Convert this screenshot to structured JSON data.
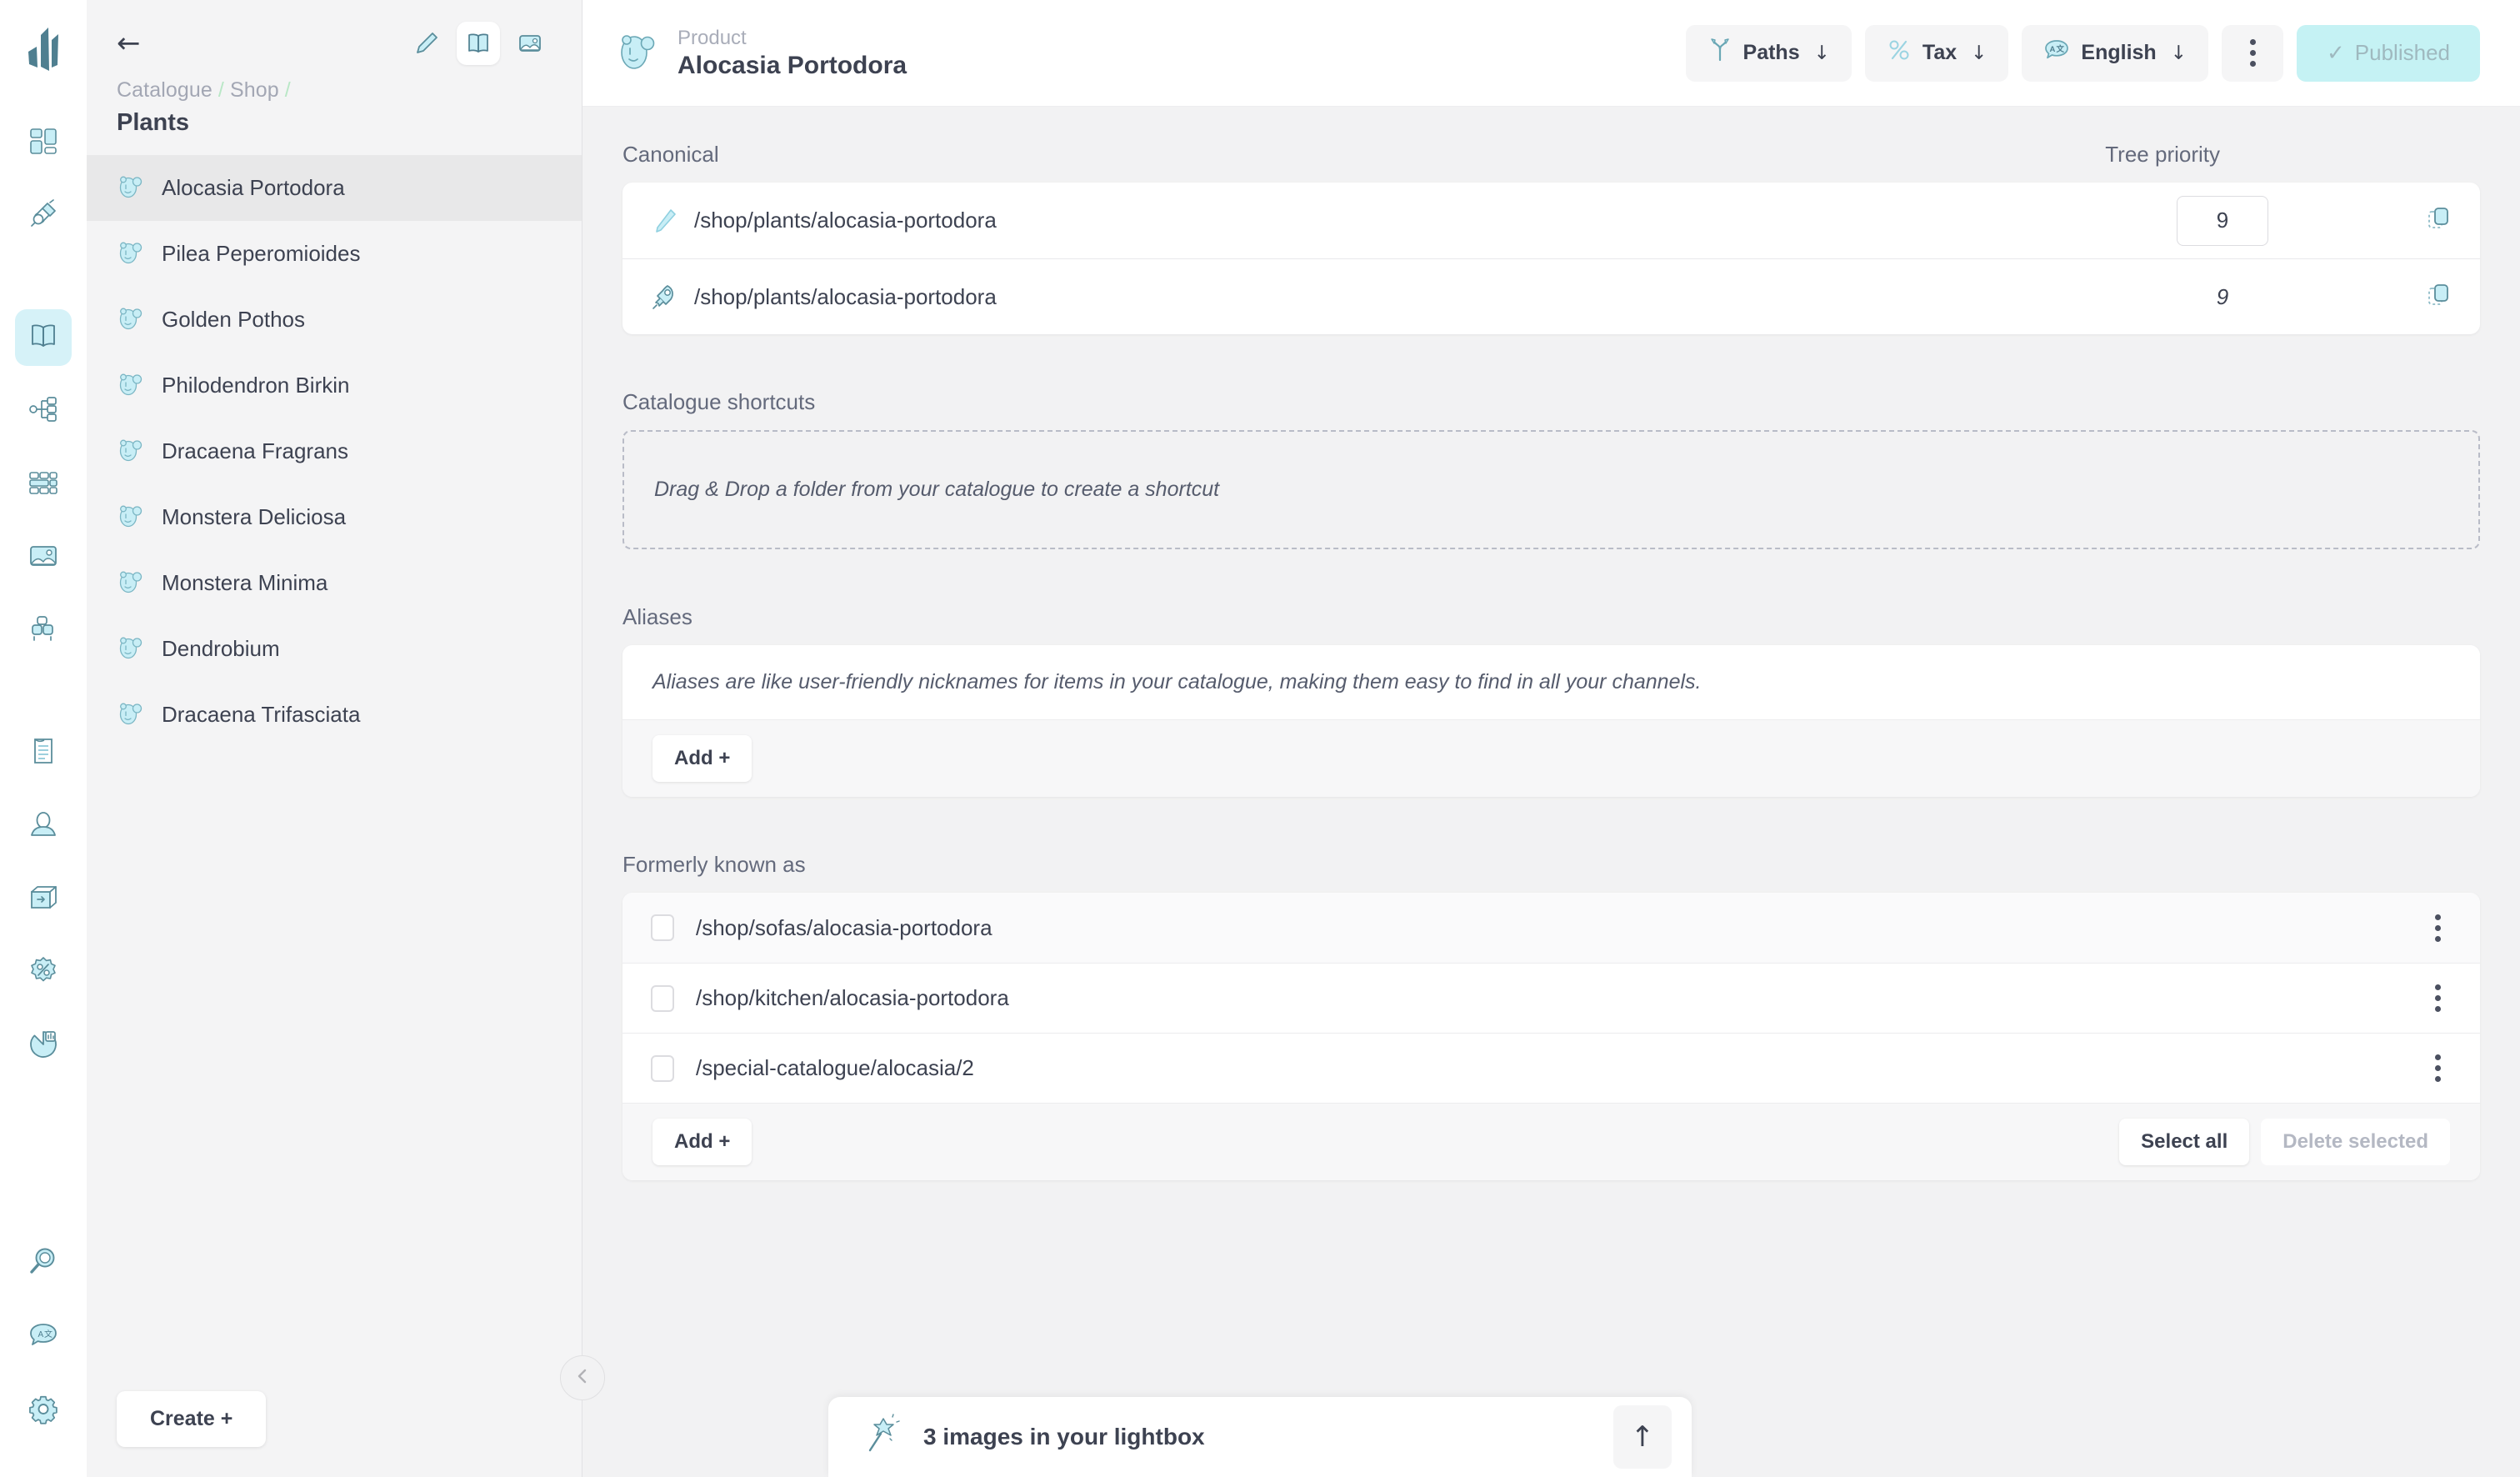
{
  "rail": {
    "logo_name": "crystallize-logo",
    "top_items": [
      {
        "name": "dashboard-icon",
        "label": "Dashboard",
        "active": false
      },
      {
        "name": "plug-icon",
        "label": "Integrations",
        "active": false
      }
    ],
    "main_items": [
      {
        "name": "catalogue-book-icon",
        "label": "Catalogue",
        "active": true
      },
      {
        "name": "topic-tree-icon",
        "label": "Topics",
        "active": false
      },
      {
        "name": "grid-layout-icon",
        "label": "Layouts",
        "active": false
      },
      {
        "name": "image-icon",
        "label": "Media",
        "active": false
      },
      {
        "name": "shapes-icon",
        "label": "Shapes",
        "active": false
      }
    ],
    "lower_items": [
      {
        "name": "document-icon",
        "label": "Documents",
        "active": false
      },
      {
        "name": "customer-icon",
        "label": "Customers",
        "active": false
      },
      {
        "name": "orders-box-icon",
        "label": "Orders",
        "active": false
      },
      {
        "name": "discount-icon",
        "label": "Discounts",
        "active": false
      },
      {
        "name": "analytics-pie-icon",
        "label": "Analytics",
        "active": false
      }
    ],
    "bottom_items": [
      {
        "name": "search-icon",
        "label": "Search",
        "active": false
      },
      {
        "name": "translate-icon",
        "label": "Translate",
        "active": false
      },
      {
        "name": "gear-icon",
        "label": "Settings",
        "active": false
      }
    ]
  },
  "panel": {
    "back_icon": "back-arrow-icon",
    "tools": [
      {
        "name": "pencil-icon",
        "label": "Edit",
        "active": false
      },
      {
        "name": "book-icon",
        "label": "Catalogue view",
        "active": true
      },
      {
        "name": "image-icon",
        "label": "Media view",
        "active": false
      }
    ],
    "breadcrumb": [
      "Catalogue",
      "Shop"
    ],
    "title": "Plants",
    "items": [
      {
        "label": "Alocasia Portodora",
        "selected": true
      },
      {
        "label": "Pilea Peperomioides",
        "selected": false
      },
      {
        "label": "Golden Pothos",
        "selected": false
      },
      {
        "label": "Philodendron Birkin",
        "selected": false
      },
      {
        "label": "Dracaena Fragrans",
        "selected": false
      },
      {
        "label": "Monstera Deliciosa",
        "selected": false
      },
      {
        "label": "Monstera Minima",
        "selected": false
      },
      {
        "label": "Dendrobium",
        "selected": false
      },
      {
        "label": "Dracaena Trifasciata",
        "selected": false
      }
    ],
    "create_label": "Create +",
    "collapse_icon": "chevron-left-icon"
  },
  "topbar": {
    "item_icon": "product-avatar-icon",
    "kicker": "Product",
    "title": "Alocasia Portodora",
    "buttons": [
      {
        "name": "paths-button",
        "icon": "paths-fork-icon",
        "label": "Paths",
        "caret": "↓"
      },
      {
        "name": "tax-button",
        "icon": "percent-icon",
        "label": "Tax",
        "caret": "↓"
      },
      {
        "name": "language-button",
        "icon": "translate-icon",
        "label": "English",
        "caret": "↓"
      }
    ],
    "more_icon": "more-vertical-icon",
    "publish": {
      "check": "✓",
      "label": "Published"
    }
  },
  "canonical": {
    "section_title": "Canonical",
    "column_title": "Tree priority",
    "rows": [
      {
        "icon": "pencil-icon",
        "path": "/shop/plants/alocasia-portodora",
        "priority": "9",
        "priority_editable": true,
        "copy_icon": "copy-icon"
      },
      {
        "icon": "rocket-icon",
        "path": "/shop/plants/alocasia-portodora",
        "priority": "9",
        "priority_editable": false,
        "copy_icon": "copy-icon"
      }
    ]
  },
  "shortcuts": {
    "section_title": "Catalogue shortcuts",
    "dropzone_text": "Drag & Drop a folder from your catalogue to create a shortcut"
  },
  "aliases": {
    "section_title": "Aliases",
    "hint": "Aliases are like user-friendly nicknames for items in your catalogue, making them easy to find in all your channels.",
    "add_label": "Add  +"
  },
  "formerly": {
    "section_title": "Formerly known as",
    "rows": [
      {
        "path": "/shop/sofas/alocasia-portodora",
        "checked": false,
        "menu_icon": "more-vertical-icon"
      },
      {
        "path": "/shop/kitchen/alocasia-portodora",
        "checked": false,
        "menu_icon": "more-vertical-icon"
      },
      {
        "path": "/special-catalogue/alocasia/2",
        "checked": false,
        "menu_icon": "more-vertical-icon"
      }
    ],
    "add_label": "Add  +",
    "select_all_label": "Select all",
    "delete_selected_label": "Delete selected"
  },
  "lightbox": {
    "icon": "magic-wand-icon",
    "text": "3 images in your lightbox",
    "expand_icon": "arrow-up-icon"
  },
  "colors": {
    "accent": "#7fd5e0",
    "accent_soft": "#c5f2f4",
    "icon_fill": "#c8eef6",
    "icon_stroke": "#5a8d9b",
    "page_bg": "#f2f2f3",
    "text": "#3d4251",
    "muted": "#a3a7b4"
  }
}
